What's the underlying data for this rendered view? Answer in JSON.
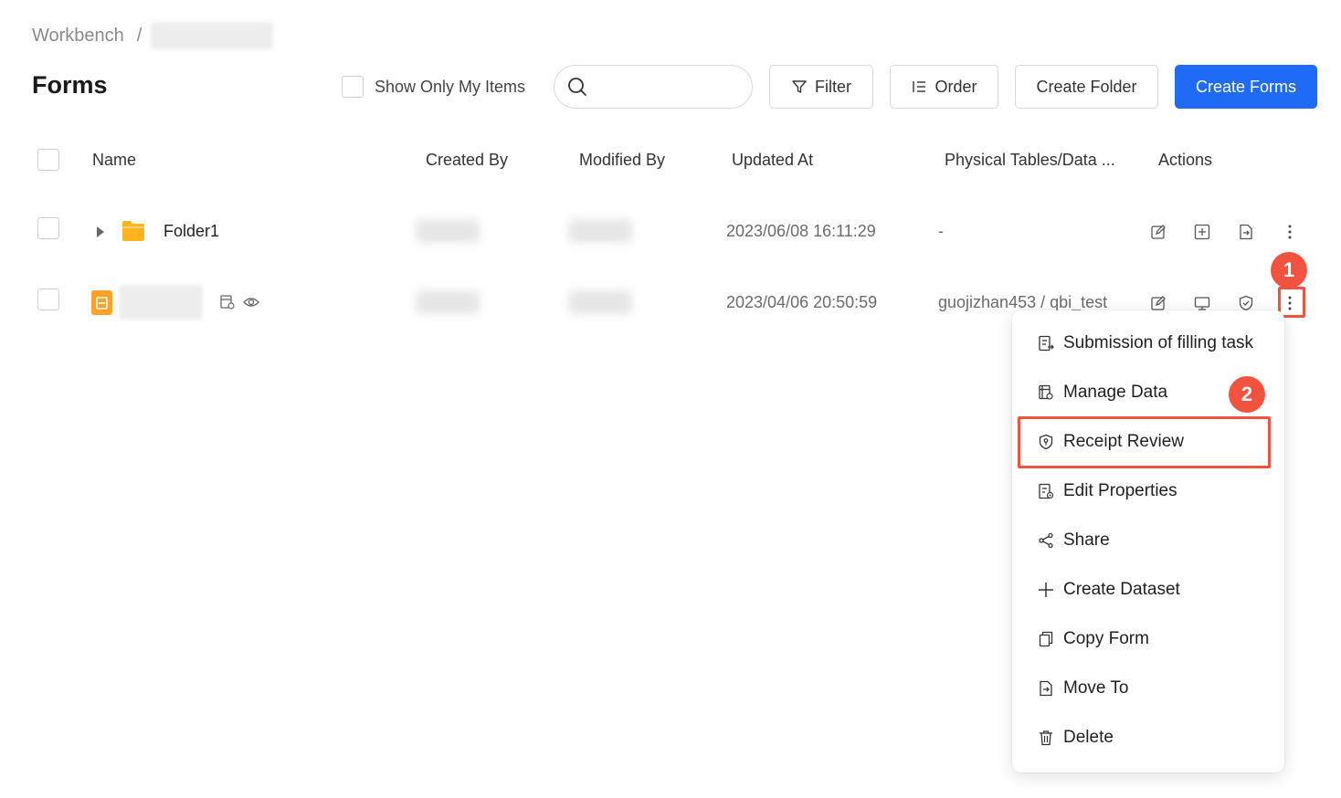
{
  "breadcrumb": {
    "root": "Workbench",
    "separator": "/"
  },
  "page": {
    "title": "Forms"
  },
  "toolbar": {
    "show_only_mine_label": "Show Only My Items",
    "search_placeholder": "",
    "filter_label": "Filter",
    "order_label": "Order",
    "create_folder_label": "Create Folder",
    "create_forms_label": "Create Forms"
  },
  "table": {
    "columns": [
      "Name",
      "Created By",
      "Modified By",
      "Updated At",
      "Physical Tables/Data ...",
      "Actions"
    ],
    "rows": [
      {
        "name": "Folder1",
        "updated_at": "2023/06/08 16:11:29",
        "physical": "-"
      },
      {
        "name": "",
        "updated_at": "2023/04/06 20:50:59",
        "physical": "guojizhan453 / qbi_test"
      }
    ]
  },
  "annotations": {
    "step1": "1",
    "step2": "2"
  },
  "menu": {
    "items": [
      {
        "label": "Submission of filling task",
        "icon": "submit-task-icon"
      },
      {
        "label": "Manage Data",
        "icon": "manage-data-icon"
      },
      {
        "label": "Receipt Review",
        "icon": "shield-icon"
      },
      {
        "label": "Edit Properties",
        "icon": "edit-properties-icon"
      },
      {
        "label": "Share",
        "icon": "share-icon"
      },
      {
        "label": "Create Dataset",
        "icon": "plus-icon"
      },
      {
        "label": "Copy Form",
        "icon": "copy-icon"
      },
      {
        "label": "Move To",
        "icon": "move-icon"
      },
      {
        "label": "Delete",
        "icon": "trash-icon"
      }
    ]
  },
  "colors": {
    "primary": "#1f6bf5",
    "annotation": "#f2533f",
    "folder": "#ffb41f",
    "form_icon": "#ffa228"
  }
}
